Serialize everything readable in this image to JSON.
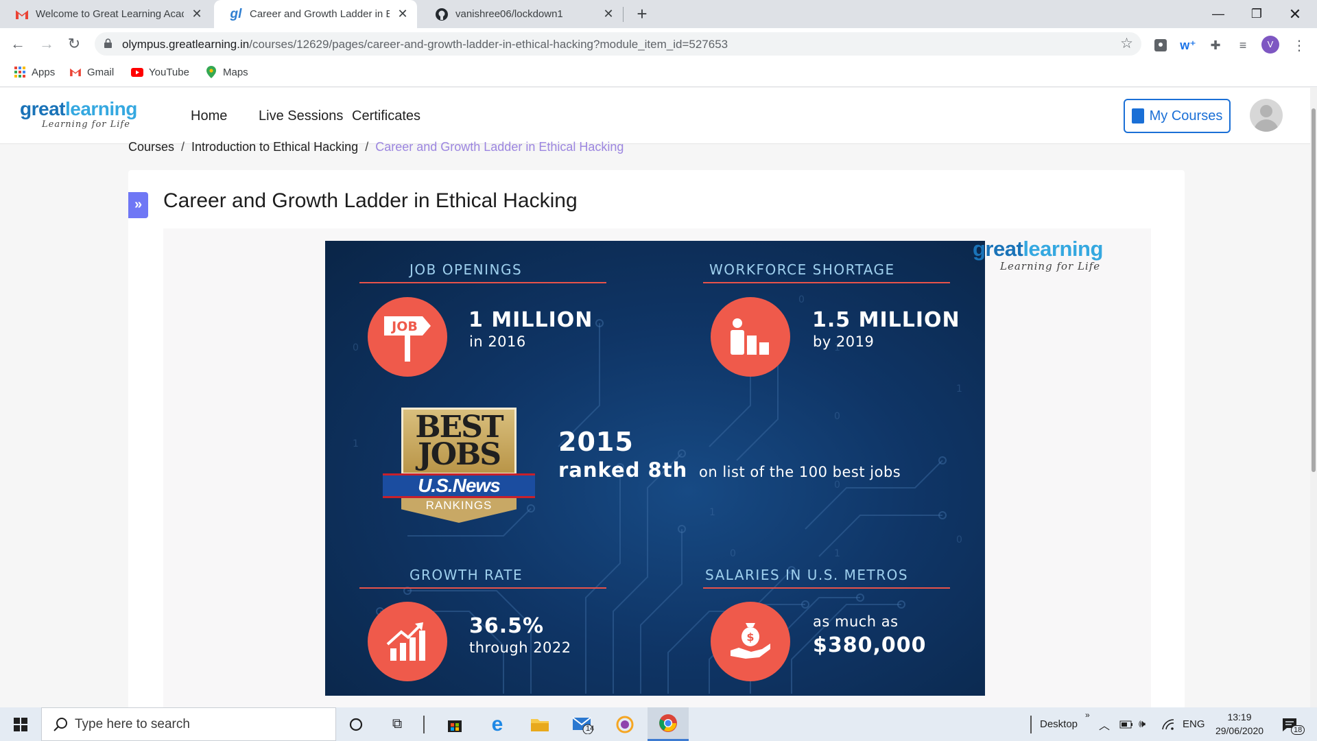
{
  "browser": {
    "tabs": [
      {
        "title": "Welcome to Great Learning Acad",
        "favicon": "gmail-icon"
      },
      {
        "title": "Career and Growth Ladder in Eth",
        "favicon": "greatlearning-icon",
        "active": true
      },
      {
        "title": "vanishree06/lockdown1",
        "favicon": "github-icon"
      }
    ],
    "url_host": "olympus.greatlearning.in",
    "url_path": "/courses/12629/pages/career-and-growth-ladder-in-ethical-hacking?module_item_id=527653",
    "profile_initial": "V",
    "bookmarks": [
      {
        "label": "Apps",
        "icon": "apps-grid-icon"
      },
      {
        "label": "Gmail",
        "icon": "gmail-icon"
      },
      {
        "label": "YouTube",
        "icon": "youtube-icon"
      },
      {
        "label": "Maps",
        "icon": "maps-pin-icon"
      }
    ]
  },
  "site": {
    "logo_text_1": "great",
    "logo_text_2": "learning",
    "logo_tagline": "Learning for Life",
    "nav": [
      "Home",
      "Live Sessions",
      "Certificates"
    ],
    "my_courses_label": "My Courses"
  },
  "breadcrumb": [
    "Courses",
    "Introduction to Ethical Hacking",
    "Career and Growth Ladder in Ethical Hacking"
  ],
  "page_title": "Career and Growth Ladder in Ethical Hacking",
  "infographic": {
    "watermark_1": "great",
    "watermark_2": "learning",
    "watermark_tagline": "Learning for Life",
    "job_openings": {
      "heading": "JOB OPENINGS",
      "icon_label": "JOB",
      "value": "1 MILLION",
      "sub": "in 2016"
    },
    "workforce_shortage": {
      "heading": "WORKFORCE SHORTAGE",
      "value": "1.5 MILLION",
      "sub": "by 2019"
    },
    "best_jobs": {
      "badge_line1": "BEST",
      "badge_line2": "JOBS",
      "badge_brand": "U.S.News",
      "badge_rank": "RANKINGS",
      "year": "2015",
      "rank": "ranked 8th",
      "rank_suffix": "on list of the 100 best jobs"
    },
    "growth_rate": {
      "heading": "GROWTH RATE",
      "value": "36.5%",
      "sub": "through 2022"
    },
    "salaries": {
      "heading": "SALARIES IN U.S. METROS",
      "pre": "as much as",
      "value": "$380,000"
    }
  },
  "taskbar": {
    "search_placeholder": "Type here to search",
    "mail_badge": "14",
    "desktop_label": "Desktop",
    "language": "ENG",
    "time": "13:19",
    "date": "29/06/2020",
    "notifications": "18"
  }
}
